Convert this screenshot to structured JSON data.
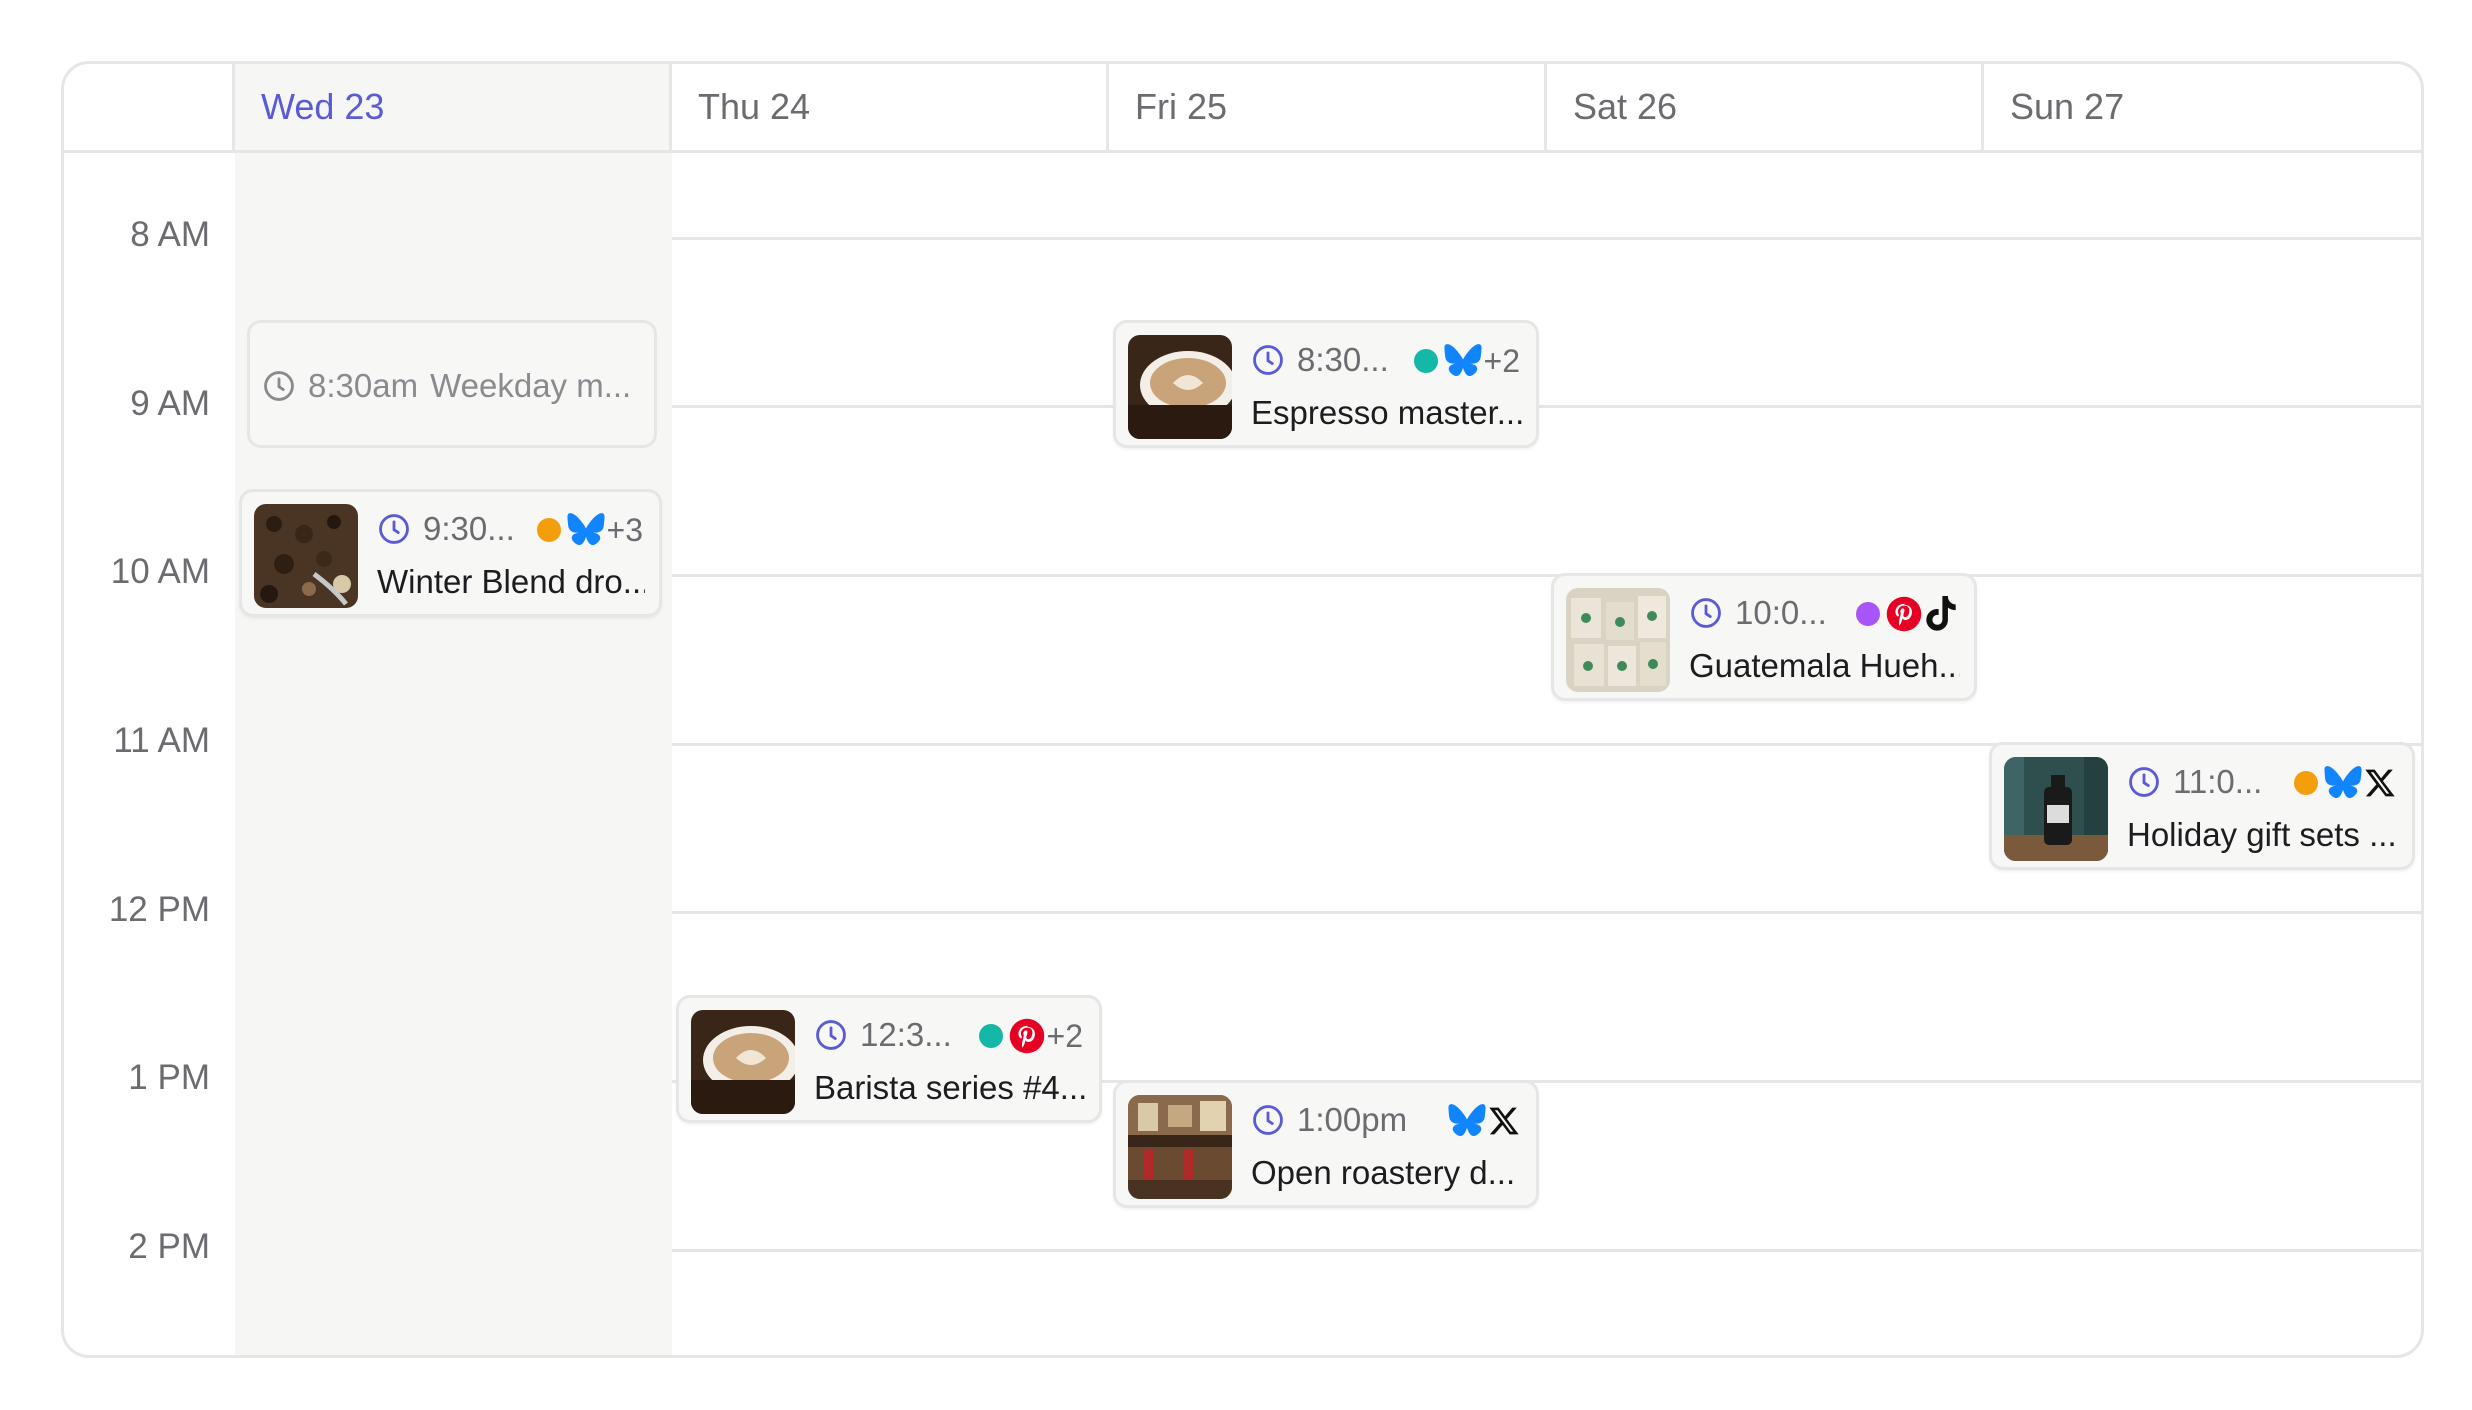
{
  "days": [
    {
      "label": "Wed 23",
      "today": true
    },
    {
      "label": "Thu 24",
      "today": false
    },
    {
      "label": "Fri 25",
      "today": false
    },
    {
      "label": "Sat 26",
      "today": false
    },
    {
      "label": "Sun 27",
      "today": false
    }
  ],
  "hours": [
    "8 AM",
    "9 AM",
    "10 AM",
    "11 AM",
    "12 PM",
    "1 PM",
    "2 PM"
  ],
  "colors": {
    "accent": "#5b5bd6",
    "teal": "#14b8a6",
    "orange": "#f59e0b",
    "purple": "#a855f7",
    "bluesky": "#1185fe",
    "pinterest": "#e60023"
  },
  "events": [
    {
      "id": "weekday",
      "time": "8:30am",
      "title": "Weekday m...",
      "simple": true
    },
    {
      "id": "winter",
      "time": "9:30...",
      "title": "Winter Blend dro...",
      "extra": "+3",
      "channels": [
        "orange-dot",
        "bluesky-icon"
      ],
      "thumb": "coffee-beans-image"
    },
    {
      "id": "espresso",
      "time": "8:30...",
      "title": "Espresso master...",
      "extra": "+2",
      "channels": [
        "teal-dot",
        "bluesky-icon"
      ],
      "thumb": "latte-cup-image"
    },
    {
      "id": "guatemala",
      "time": "10:0...",
      "title": "Guatemala Hueh...",
      "extra": "",
      "channels": [
        "purple-dot",
        "pinterest-icon",
        "tiktok-icon"
      ],
      "thumb": "coffee-bags-image"
    },
    {
      "id": "holiday",
      "time": "11:0...",
      "title": "Holiday gift sets ...",
      "extra": "",
      "channels": [
        "orange-dot",
        "bluesky-icon",
        "x-icon"
      ],
      "thumb": "gift-bottle-image"
    },
    {
      "id": "barista",
      "time": "12:3...",
      "title": "Barista series #4...",
      "extra": "+2",
      "channels": [
        "teal-dot",
        "pinterest-icon"
      ],
      "thumb": "latte-cup-image"
    },
    {
      "id": "roastery",
      "time": "1:00pm",
      "title": "Open roastery d...",
      "extra": "",
      "channels": [
        "bluesky-icon",
        "x-icon"
      ],
      "thumb": "cafe-interior-image"
    }
  ]
}
